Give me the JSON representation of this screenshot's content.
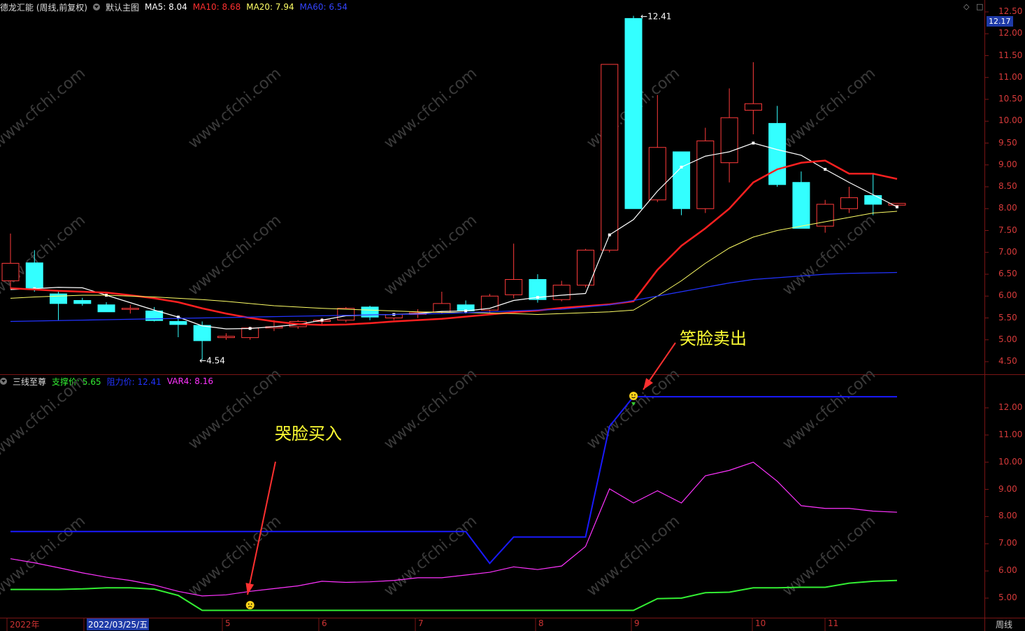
{
  "main_header": {
    "stock_name": "德龙汇能 (周线,前复权)",
    "indicator_name": "默认主图",
    "ma5": "MA5: 8.04",
    "ma10": "MA10: 8.68",
    "ma20": "MA20: 7.94",
    "ma60": "MA60: 6.54"
  },
  "sub_header": {
    "indicator_name": "三线至尊",
    "support": "支撑价: 5.65",
    "resistance": "阻力价: 12.41",
    "var4": "VAR4: 8.16"
  },
  "buttons": {
    "diamond": "◇",
    "maximize": "□"
  },
  "current_price": "12.17",
  "main_y_ticks": [
    "12.50",
    "12.00",
    "11.50",
    "11.00",
    "10.50",
    "10.00",
    "9.50",
    "9.00",
    "8.50",
    "8.00",
    "7.50",
    "7.00",
    "6.50",
    "6.00",
    "5.50",
    "5.00",
    "4.50"
  ],
  "sub_y_ticks": [
    "12.00",
    "11.00",
    "10.00",
    "9.00",
    "8.00",
    "7.00",
    "6.00",
    "5.00"
  ],
  "high_label": "12.41",
  "low_label": "4.54",
  "x_labels": [
    "2022年",
    "2022/03/25/五",
    "5",
    "6",
    "7",
    "8",
    "9",
    "10",
    "11"
  ],
  "period_label": "周线",
  "annotations": {
    "sell": "笑脸卖出",
    "buy": "哭脸买入"
  },
  "watermark": "www.cfchi.com",
  "colors": {
    "up": "#ff3b3b",
    "down": "#33ffff",
    "ma5": "#ffffff",
    "ma10": "#ff2020",
    "ma20": "#ffff66",
    "ma60": "#2233ff",
    "support": "#33ee33",
    "resistance": "#1a1aff",
    "var4": "#ff33ff",
    "annotation": "#ffff33",
    "arrow": "#ff3030"
  },
  "chart_data": [
    {
      "type": "candlestick",
      "title": "德龙汇能 (周线,前复权)",
      "ylim": [
        4.3,
        12.6
      ],
      "candles": [
        {
          "o": 6.35,
          "h": 7.43,
          "l": 6.16,
          "c": 6.75
        },
        {
          "o": 6.76,
          "h": 7.05,
          "l": 6.1,
          "c": 6.18
        },
        {
          "o": 6.05,
          "h": 6.12,
          "l": 5.45,
          "c": 5.83
        },
        {
          "o": 5.9,
          "h": 5.96,
          "l": 5.78,
          "c": 5.83
        },
        {
          "o": 5.8,
          "h": 5.86,
          "l": 5.66,
          "c": 5.64
        },
        {
          "o": 5.7,
          "h": 5.8,
          "l": 5.6,
          "c": 5.72
        },
        {
          "o": 5.66,
          "h": 5.75,
          "l": 5.42,
          "c": 5.44
        },
        {
          "o": 5.42,
          "h": 5.5,
          "l": 5.06,
          "c": 5.35
        },
        {
          "o": 5.33,
          "h": 5.42,
          "l": 4.54,
          "c": 4.98
        },
        {
          "o": 5.05,
          "h": 5.15,
          "l": 5.0,
          "c": 5.08
        },
        {
          "o": 5.05,
          "h": 5.3,
          "l": 5.0,
          "c": 5.27
        },
        {
          "o": 5.27,
          "h": 5.45,
          "l": 5.2,
          "c": 5.3
        },
        {
          "o": 5.3,
          "h": 5.45,
          "l": 5.25,
          "c": 5.42
        },
        {
          "o": 5.42,
          "h": 5.5,
          "l": 5.35,
          "c": 5.45
        },
        {
          "o": 5.45,
          "h": 5.75,
          "l": 5.4,
          "c": 5.72
        },
        {
          "o": 5.75,
          "h": 5.78,
          "l": 5.45,
          "c": 5.52
        },
        {
          "o": 5.5,
          "h": 5.6,
          "l": 5.45,
          "c": 5.58
        },
        {
          "o": 5.58,
          "h": 5.7,
          "l": 5.5,
          "c": 5.62
        },
        {
          "o": 5.63,
          "h": 6.1,
          "l": 5.6,
          "c": 5.83
        },
        {
          "o": 5.8,
          "h": 5.9,
          "l": 5.6,
          "c": 5.66
        },
        {
          "o": 5.68,
          "h": 6.05,
          "l": 5.62,
          "c": 6.0
        },
        {
          "o": 6.03,
          "h": 7.2,
          "l": 5.95,
          "c": 6.38
        },
        {
          "o": 6.38,
          "h": 6.5,
          "l": 5.85,
          "c": 5.92
        },
        {
          "o": 5.92,
          "h": 6.35,
          "l": 5.88,
          "c": 6.25
        },
        {
          "o": 6.25,
          "h": 7.08,
          "l": 6.2,
          "c": 7.05
        },
        {
          "o": 7.05,
          "h": 11.3,
          "l": 7.0,
          "c": 11.3
        },
        {
          "o": 12.35,
          "h": 12.41,
          "l": 8.0,
          "c": 8.0
        },
        {
          "o": 8.2,
          "h": 10.6,
          "l": 8.15,
          "c": 9.4
        },
        {
          "o": 9.3,
          "h": 9.3,
          "l": 7.85,
          "c": 8.0
        },
        {
          "o": 8.0,
          "h": 9.85,
          "l": 7.9,
          "c": 9.55
        },
        {
          "o": 9.05,
          "h": 10.75,
          "l": 8.6,
          "c": 10.08
        },
        {
          "o": 10.25,
          "h": 11.35,
          "l": 9.7,
          "c": 10.4
        },
        {
          "o": 9.95,
          "h": 10.35,
          "l": 8.5,
          "c": 8.55
        },
        {
          "o": 8.6,
          "h": 8.85,
          "l": 7.55,
          "c": 7.55
        },
        {
          "o": 7.6,
          "h": 8.2,
          "l": 7.45,
          "c": 8.1
        },
        {
          "o": 8.0,
          "h": 8.5,
          "l": 7.9,
          "c": 8.25
        },
        {
          "o": 8.3,
          "h": 8.8,
          "l": 7.85,
          "c": 8.1
        },
        {
          "o": 8.08,
          "h": 8.12,
          "l": 8.02,
          "c": 8.12
        }
      ],
      "series": [
        {
          "name": "MA5",
          "values": [
            6.15,
            6.17,
            6.2,
            6.19,
            6.02,
            5.85,
            5.68,
            5.52,
            5.32,
            5.25,
            5.26,
            5.3,
            5.35,
            5.45,
            5.55,
            5.57,
            5.58,
            5.6,
            5.65,
            5.66,
            5.72,
            5.9,
            5.97,
            6.02,
            6.06,
            7.4,
            7.75,
            8.4,
            8.95,
            9.2,
            9.3,
            9.5,
            9.35,
            9.22,
            8.9,
            8.6,
            8.32,
            8.04
          ]
        },
        {
          "name": "MA10",
          "values": [
            6.18,
            6.15,
            6.12,
            6.1,
            6.08,
            6.02,
            5.95,
            5.86,
            5.72,
            5.6,
            5.5,
            5.42,
            5.36,
            5.34,
            5.35,
            5.38,
            5.42,
            5.45,
            5.48,
            5.53,
            5.58,
            5.63,
            5.67,
            5.73,
            5.77,
            5.81,
            5.88,
            6.6,
            7.15,
            7.55,
            8.0,
            8.6,
            8.9,
            9.05,
            9.1,
            8.8,
            8.8,
            8.68
          ]
        },
        {
          "name": "MA20",
          "values": [
            5.95,
            5.98,
            6.0,
            6.02,
            6.02,
            6.0,
            5.98,
            5.95,
            5.92,
            5.88,
            5.83,
            5.78,
            5.75,
            5.72,
            5.7,
            5.68,
            5.66,
            5.64,
            5.63,
            5.62,
            5.61,
            5.6,
            5.58,
            5.6,
            5.62,
            5.64,
            5.68,
            6.0,
            6.35,
            6.75,
            7.1,
            7.35,
            7.5,
            7.6,
            7.7,
            7.8,
            7.9,
            7.94
          ]
        },
        {
          "name": "MA60",
          "values": [
            5.42,
            5.43,
            5.44,
            5.45,
            5.46,
            5.47,
            5.48,
            5.49,
            5.5,
            5.51,
            5.52,
            5.53,
            5.54,
            5.55,
            5.56,
            5.57,
            5.58,
            5.59,
            5.6,
            5.62,
            5.64,
            5.66,
            5.68,
            5.7,
            5.75,
            5.8,
            5.9,
            6.0,
            6.1,
            6.2,
            6.3,
            6.38,
            6.42,
            6.46,
            6.5,
            6.52,
            6.53,
            6.54
          ]
        }
      ]
    },
    {
      "type": "line",
      "title": "三线至尊",
      "ylim": [
        4.5,
        13.0
      ],
      "series": [
        {
          "name": "支撑价",
          "values": [
            5.32,
            5.32,
            5.32,
            5.34,
            5.38,
            5.38,
            5.33,
            5.1,
            4.55,
            4.55,
            4.55,
            4.55,
            4.55,
            4.55,
            4.55,
            4.55,
            4.55,
            4.55,
            4.55,
            4.55,
            4.55,
            4.55,
            4.55,
            4.55,
            4.55,
            4.55,
            4.55,
            4.98,
            5.0,
            5.2,
            5.22,
            5.38,
            5.38,
            5.4,
            5.4,
            5.55,
            5.62,
            5.65
          ]
        },
        {
          "name": "阻力价",
          "values": [
            7.45,
            7.45,
            7.45,
            7.45,
            7.45,
            7.45,
            7.45,
            7.45,
            7.45,
            7.45,
            7.45,
            7.45,
            7.45,
            7.45,
            7.45,
            7.45,
            7.45,
            7.45,
            7.45,
            7.45,
            6.28,
            7.25,
            7.25,
            7.25,
            7.25,
            11.32,
            12.41,
            12.41,
            12.41,
            12.41,
            12.41,
            12.41,
            12.41,
            12.41,
            12.41,
            12.41,
            12.41,
            12.41
          ]
        },
        {
          "name": "VAR4",
          "values": [
            6.45,
            6.3,
            6.12,
            5.93,
            5.77,
            5.65,
            5.48,
            5.25,
            5.08,
            5.12,
            5.25,
            5.35,
            5.45,
            5.62,
            5.58,
            5.6,
            5.65,
            5.75,
            5.75,
            5.85,
            5.95,
            6.15,
            6.05,
            6.18,
            6.9,
            9.02,
            8.5,
            8.95,
            8.5,
            9.5,
            9.7,
            10.0,
            9.3,
            8.4,
            8.3,
            8.3,
            8.2,
            8.16
          ]
        }
      ]
    }
  ]
}
